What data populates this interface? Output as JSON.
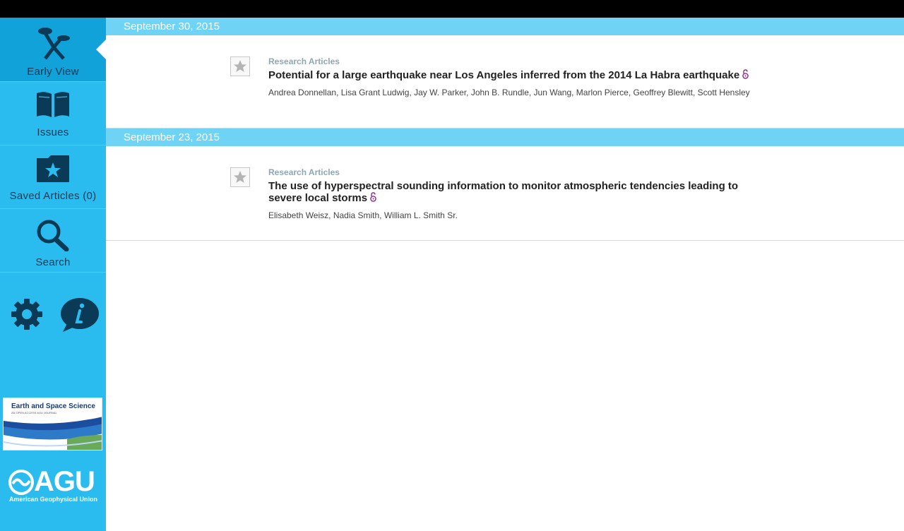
{
  "sidebar": {
    "items": [
      {
        "label": "Early View",
        "icon": "early-view-icon",
        "active": true
      },
      {
        "label": "Issues",
        "icon": "book-icon"
      },
      {
        "label": "Saved Articles (0)",
        "icon": "folder-star-icon"
      },
      {
        "label": "Search",
        "icon": "search-icon"
      }
    ],
    "settings_icon": "gear-icon",
    "info_icon": "info-icon",
    "journal_logo": {
      "title": "Earth and Space Science",
      "subtitle": "AN OPEN ACCESS AGU JOURNAL"
    },
    "agu_logo": {
      "name": "AGU",
      "full_name": "American Geophysical Union"
    }
  },
  "colors": {
    "sidebar": "#2bbcef",
    "sidebar_active": "#11a2d9",
    "date_header": "#6fd3f6",
    "open_access": "#8a2a8a"
  },
  "sections": [
    {
      "date": "September 30, 2015",
      "articles": [
        {
          "category": "Research Articles",
          "title": "Potential for a large earthquake near Los Angeles inferred from the 2014 La Habra earthquake",
          "authors": "Andrea Donnellan, Lisa Grant Ludwig, Jay W. Parker, John B. Rundle, Jun Wang, Marlon Pierce, Geoffrey Blewitt, Scott Hensley",
          "open_access": true
        }
      ]
    },
    {
      "date": "September 23, 2015",
      "articles": [
        {
          "category": "Research Articles",
          "title": "The use of hyperspectral sounding information to monitor atmospheric tendencies leading to severe local storms",
          "authors": "Elisabeth Weisz, Nadia Smith, William L. Smith Sr.",
          "open_access": true
        }
      ]
    }
  ]
}
